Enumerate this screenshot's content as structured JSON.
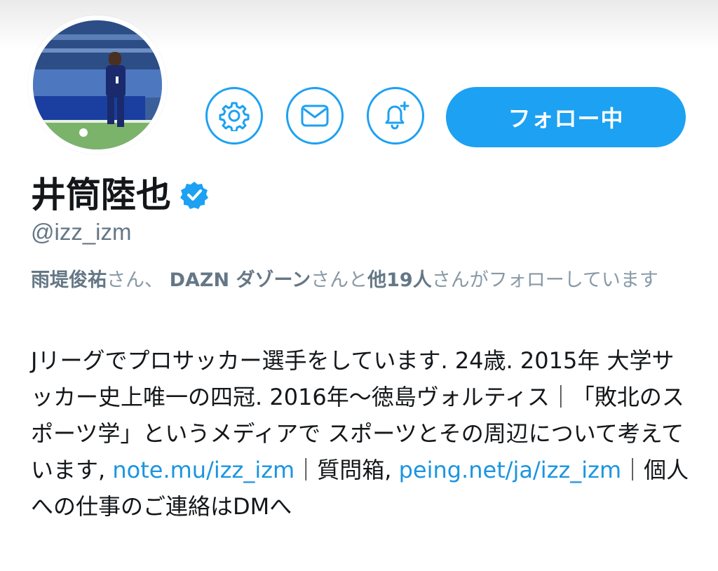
{
  "profile": {
    "display_name": "井筒陸也",
    "handle": "@izz_izm",
    "verified": true
  },
  "actions": {
    "follow_label": "フォロー中",
    "icons": [
      "gear-icon",
      "envelope-icon",
      "bell-plus-icon"
    ]
  },
  "followed_by": {
    "user1": "雨堤俊祐",
    "sep1": "さん、 ",
    "user2": "DAZN ダゾーン",
    "sep2": "さんと",
    "others": "他19人",
    "tail": "さんがフォローしています"
  },
  "bio": {
    "text1": "Jリーグでプロサッカー選手をしています. 24歳. 2015年 大学サッカー史上唯一の四冠. 2016年〜徳島ヴォルティス｜「敗北のスポーツ学」というメディアで スポーツとその周辺について考えています, ",
    "link1": "note.mu/izz_izm",
    "text2": "｜質問箱, ",
    "link2": "peing.net/ja/izz_izm",
    "text3": "｜個人への仕事のご連絡はDMへ"
  },
  "colors": {
    "accent": "#1da1f2",
    "link": "#1b95e0",
    "text": "#14171a",
    "muted": "#657786"
  }
}
